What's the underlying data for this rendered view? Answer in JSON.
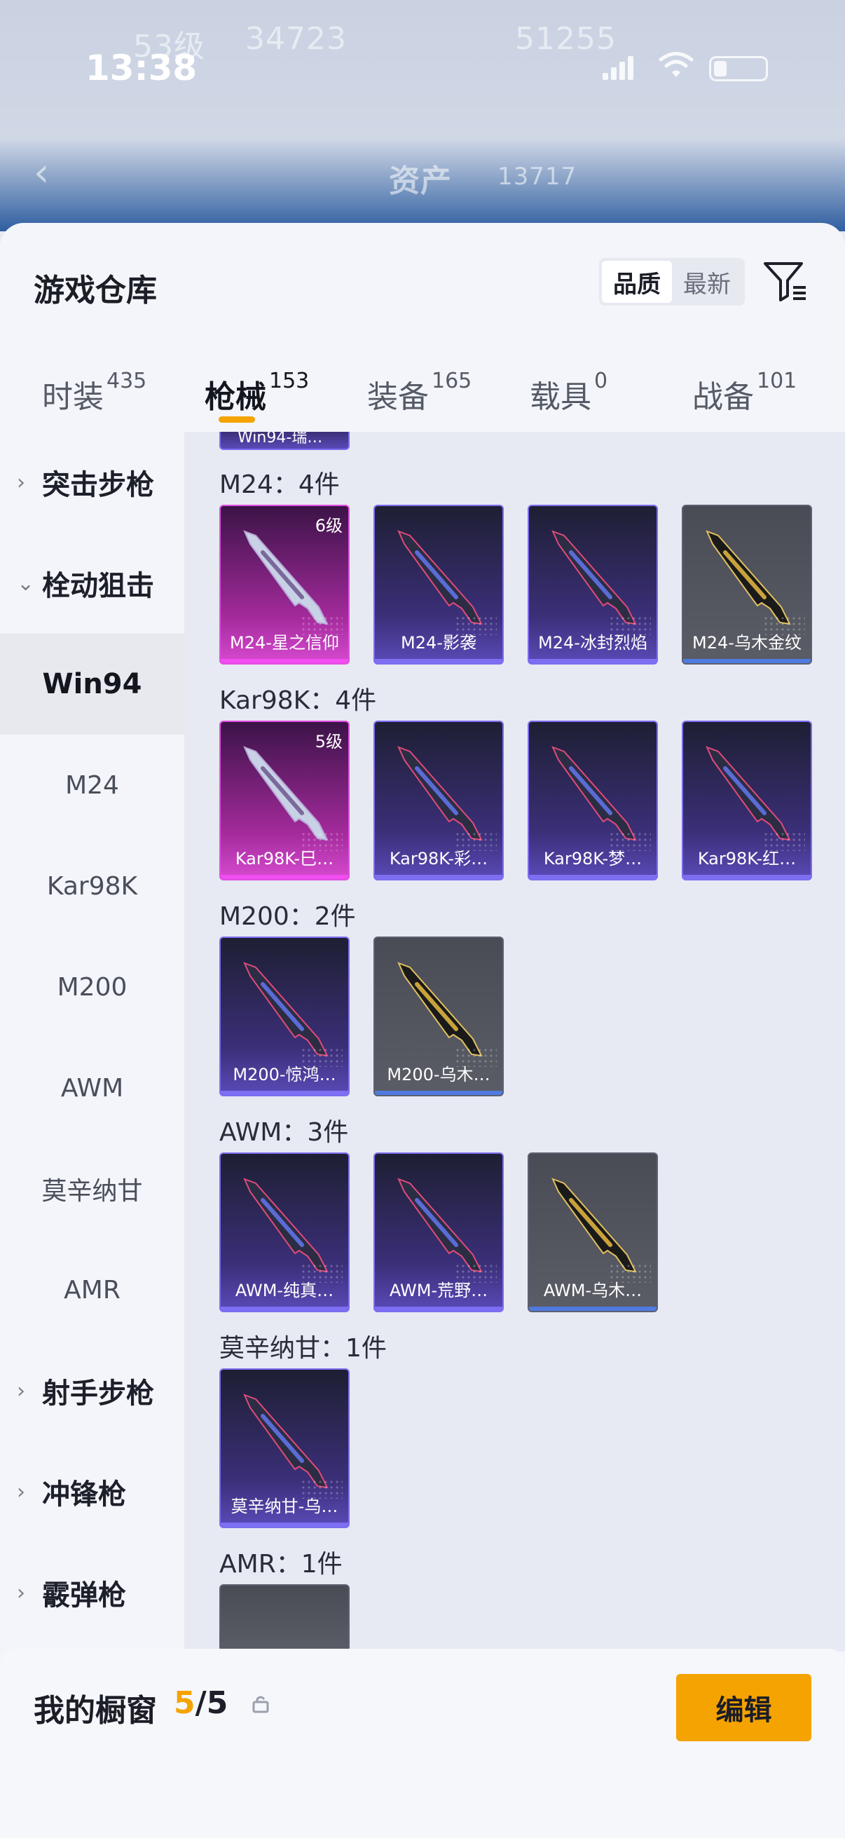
{
  "status_bar": {
    "time": "13:38"
  },
  "background_header": {
    "ghost_text_1": "53级",
    "ghost_text_2": "34723",
    "ghost_text_3": "51255",
    "ghost_title": "资产",
    "ghost_num": "13717"
  },
  "sheet": {
    "title": "游戏仓库",
    "sort_options": [
      "品质",
      "最新"
    ],
    "active_sort": 0
  },
  "tabs": [
    {
      "label": "时装",
      "count": "435"
    },
    {
      "label": "枪械",
      "count": "153"
    },
    {
      "label": "装备",
      "count": "165"
    },
    {
      "label": "载具",
      "count": "0"
    },
    {
      "label": "战备",
      "count": "101"
    }
  ],
  "active_tab": 1,
  "sidebar": {
    "items": [
      {
        "label": "突击步枪",
        "type": "category",
        "chevron": "›"
      },
      {
        "label": "栓动狙击",
        "type": "category",
        "chevron": "⌄"
      },
      {
        "label": "Win94",
        "type": "sub",
        "selected": true
      },
      {
        "label": "M24",
        "type": "sub"
      },
      {
        "label": "Kar98K",
        "type": "sub"
      },
      {
        "label": "M200",
        "type": "sub"
      },
      {
        "label": "AWM",
        "type": "sub"
      },
      {
        "label": "莫辛纳甘",
        "type": "sub"
      },
      {
        "label": "AMR",
        "type": "sub"
      },
      {
        "label": "射手步枪",
        "type": "category",
        "chevron": "›"
      },
      {
        "label": "冲锋枪",
        "type": "category",
        "chevron": "›"
      },
      {
        "label": "霰弹枪",
        "type": "category",
        "chevron": "›"
      }
    ]
  },
  "content": {
    "top_cut_label": "Win94-瑞…",
    "groups": [
      {
        "title": "M24：4件",
        "cards": [
          {
            "name": "M24-星之信仰",
            "level": "6级",
            "rarity": "pink"
          },
          {
            "name": "M24-影袭",
            "rarity": "purple"
          },
          {
            "name": "M24-冰封烈焰",
            "rarity": "purple"
          },
          {
            "name": "M24-乌木金纹",
            "rarity": "gray"
          }
        ]
      },
      {
        "title": "Kar98K：4件",
        "cards": [
          {
            "name": "Kar98K-巳…",
            "level": "5级",
            "rarity": "pink"
          },
          {
            "name": "Kar98K-彩…",
            "rarity": "purple"
          },
          {
            "name": "Kar98K-梦…",
            "rarity": "purple"
          },
          {
            "name": "Kar98K-红…",
            "rarity": "purple"
          }
        ]
      },
      {
        "title": "M200：2件",
        "cards": [
          {
            "name": "M200-惊鸿…",
            "rarity": "purple"
          },
          {
            "name": "M200-乌木…",
            "rarity": "gray"
          }
        ]
      },
      {
        "title": "AWM：3件",
        "cards": [
          {
            "name": "AWM-纯真…",
            "rarity": "purple"
          },
          {
            "name": "AWM-荒野…",
            "rarity": "purple"
          },
          {
            "name": "AWM-乌木…",
            "rarity": "gray"
          }
        ]
      },
      {
        "title": "莫辛纳甘：1件",
        "cards": [
          {
            "name": "莫辛纳甘-乌…",
            "rarity": "purple"
          }
        ]
      },
      {
        "title": "AMR：1件",
        "cards": []
      }
    ]
  },
  "fab": {
    "icon": "share-external-icon"
  },
  "bottom_bar": {
    "title": "我的橱窗",
    "current": "5",
    "total": "/5",
    "edit_label": "编辑"
  },
  "colors": {
    "accent": "#f5a300",
    "purple_rarity": "#7d6ff2",
    "pink_rarity": "#f14df0",
    "gray_rarity": "#4f7ae0"
  }
}
